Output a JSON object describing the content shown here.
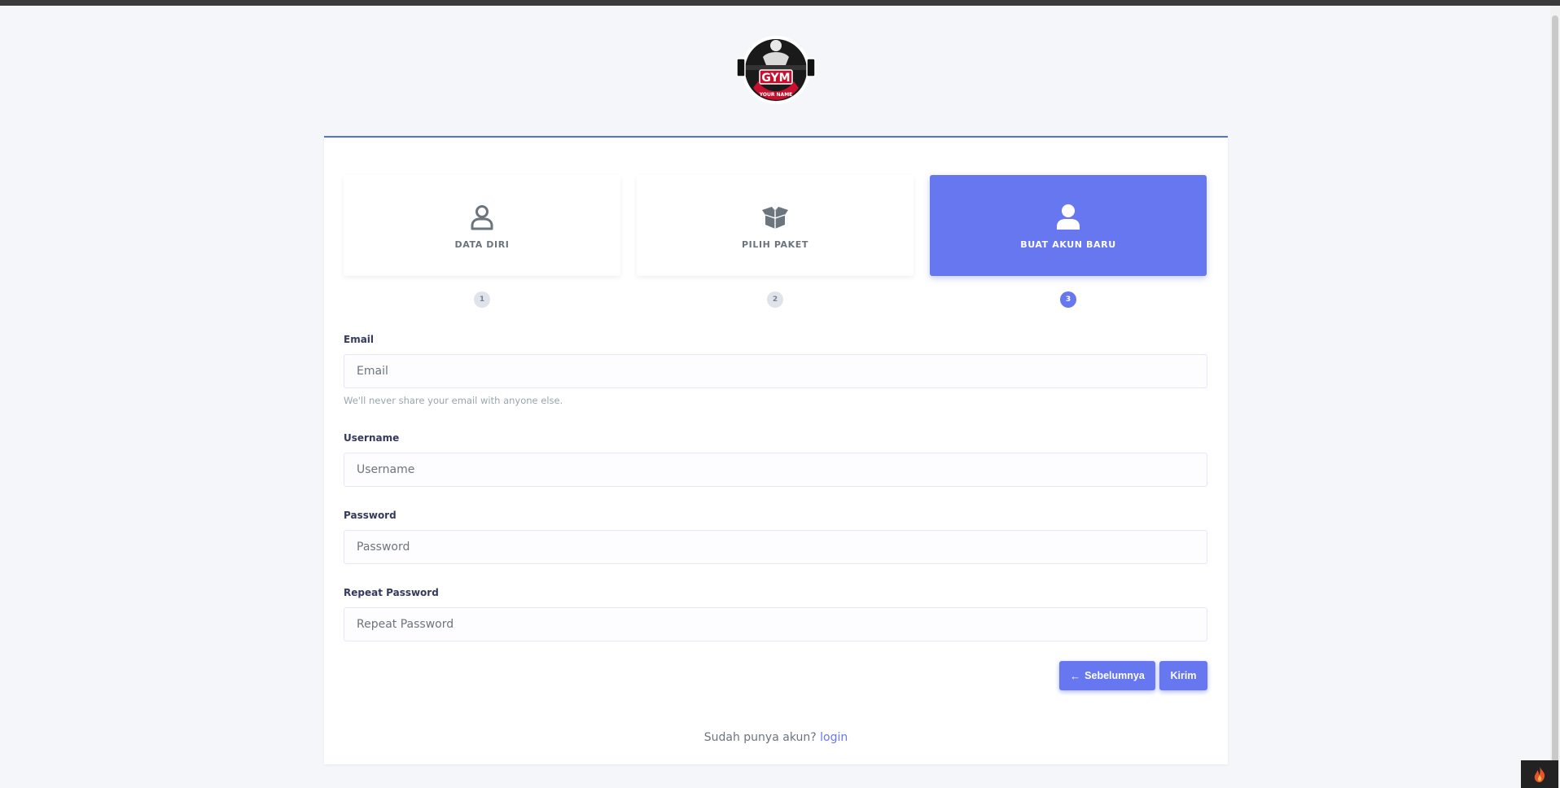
{
  "brand": {
    "logo_text": "GYM",
    "logo_subtext": "YOUR NAME"
  },
  "steps": [
    {
      "number": "1",
      "label": "DATA DIRI",
      "icon": "user-outline-icon",
      "active": false
    },
    {
      "number": "2",
      "label": "PILIH PAKET",
      "icon": "box-open-icon",
      "active": false
    },
    {
      "number": "3",
      "label": "BUAT AKUN BARU",
      "icon": "user-solid-icon",
      "active": true
    }
  ],
  "form": {
    "email": {
      "label": "Email",
      "placeholder": "Email",
      "value": "",
      "help": "We'll never share your email with anyone else."
    },
    "username": {
      "label": "Username",
      "placeholder": "Username",
      "value": ""
    },
    "password": {
      "label": "Password",
      "placeholder": "Password",
      "value": ""
    },
    "repeat_password": {
      "label": "Repeat Password",
      "placeholder": "Repeat Password",
      "value": ""
    }
  },
  "buttons": {
    "previous_label": "Sebelumnya",
    "previous_icon": "arrow-left-icon",
    "submit_label": "Kirim"
  },
  "footer": {
    "prompt": "Sudah punya akun?",
    "link_label": "login"
  },
  "colors": {
    "primary": "#6777ef",
    "card_top_border": "#4e73df",
    "background": "#f4f6fa"
  }
}
